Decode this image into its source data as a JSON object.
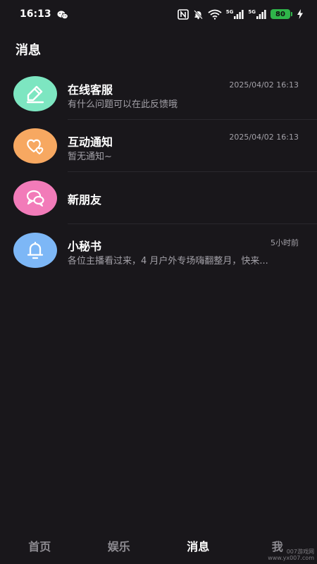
{
  "status_bar": {
    "time": "16:13",
    "wechat_icon": "wechat-icon",
    "nfc_icon": "nfc-icon",
    "mute_icon": "bell-off-icon",
    "wifi_icon": "wifi-icon",
    "signal1_label": "5G",
    "signal2_label": "5G",
    "battery": "80",
    "charging_icon": "bolt-icon"
  },
  "page": {
    "title": "消息"
  },
  "messages": [
    {
      "name": "在线客服",
      "preview": "有什么问题可以在此反馈哦",
      "time": "2025/04/02 16:13",
      "icon": "pencil-icon",
      "color": "#7de6c1"
    },
    {
      "name": "互动通知",
      "preview": "暂无通知~",
      "time": "2025/04/02 16:13",
      "icon": "hearts-icon",
      "color": "#f7a861"
    },
    {
      "name": "新朋友",
      "preview": "",
      "time": "",
      "icon": "chat-bubbles-icon",
      "color": "#f27bb9"
    },
    {
      "name": "小秘书",
      "preview": "各位主播看过来，4 月户外专场嗨翻整月，快来...",
      "time": "5小时前",
      "icon": "bell-icon",
      "color": "#7db7f6"
    }
  ],
  "bottom_nav": {
    "items": [
      {
        "label": "首页"
      },
      {
        "label": "娱乐"
      },
      {
        "label": "消息"
      },
      {
        "label": "我"
      }
    ],
    "active_index": 2
  },
  "watermark": {
    "line1": "007游戏网",
    "line2": "www.yx007.com"
  }
}
